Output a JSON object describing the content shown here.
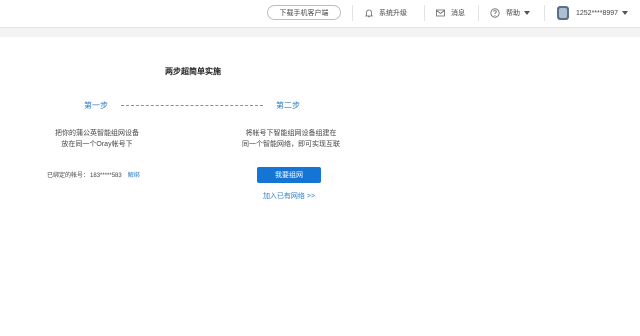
{
  "header": {
    "download_client": "下载手机客户端",
    "system_upgrade": "系统升级",
    "messages": "消息",
    "help": "帮助",
    "account": "1252****8997"
  },
  "main": {
    "title": "两步超简单实施",
    "step1": {
      "label": "第一步",
      "desc_line1": "把你的蒲公英智能组网设备",
      "desc_line2": "放在同一个Oray帐号下",
      "bound_label": "已绑定的帐号：",
      "bound_account": "183*****583",
      "unbind": "解绑"
    },
    "step2": {
      "label": "第二步",
      "desc_line1": "将帐号下智能组网设备组建在",
      "desc_line2": "同一个智能网络，即可实现互联",
      "primary_button": "我要组网",
      "join_link": "加入已有网络 >>"
    }
  },
  "colors": {
    "accent": "#1575d5",
    "link": "#2d7dc6"
  }
}
